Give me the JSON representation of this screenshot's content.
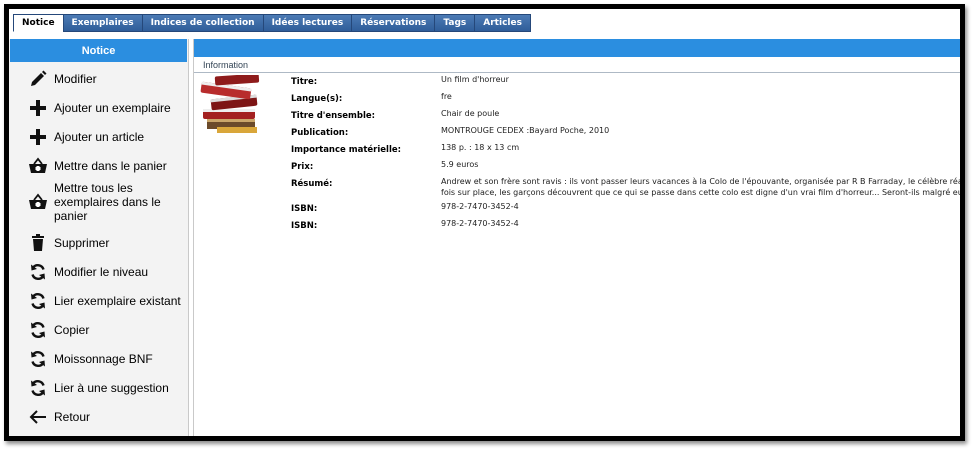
{
  "tabs": [
    {
      "label": "Notice",
      "active": true
    },
    {
      "label": "Exemplaires",
      "active": false
    },
    {
      "label": "Indices de collection",
      "active": false
    },
    {
      "label": "Idées lectures",
      "active": false
    },
    {
      "label": "Réservations",
      "active": false
    },
    {
      "label": "Tags",
      "active": false
    },
    {
      "label": "Articles",
      "active": false
    }
  ],
  "sidebar": {
    "header": "Notice",
    "items": [
      {
        "label": "Modifier",
        "icon": "pencil-icon"
      },
      {
        "label": "Ajouter un exemplaire",
        "icon": "plus-icon"
      },
      {
        "label": "Ajouter un article",
        "icon": "plus-icon"
      },
      {
        "label": "Mettre dans le panier",
        "icon": "basket-icon"
      },
      {
        "label": "Mettre tous les exemplaires dans le panier",
        "icon": "basket-icon"
      },
      {
        "label": "Supprimer",
        "icon": "trash-icon"
      },
      {
        "label": "Modifier le niveau",
        "icon": "refresh-icon"
      },
      {
        "label": "Lier exemplaire existant",
        "icon": "refresh-icon"
      },
      {
        "label": "Copier",
        "icon": "refresh-icon"
      },
      {
        "label": "Moissonnage BNF",
        "icon": "refresh-icon"
      },
      {
        "label": "Lier à une suggestion",
        "icon": "refresh-icon"
      },
      {
        "label": "Retour",
        "icon": "arrow-left-icon"
      }
    ]
  },
  "main": {
    "section_title": "Information",
    "cover_icon": "books-icon",
    "fields": [
      {
        "key": "Titre:",
        "value": "Un film d'horreur"
      },
      {
        "key": "Langue(s):",
        "value": "fre"
      },
      {
        "key": "Titre d'ensemble:",
        "value": "Chair de poule"
      },
      {
        "key": "Publication:",
        "value": "MONTROUGE CEDEX :Bayard Poche, 2010"
      },
      {
        "key": "Importance matérielle:",
        "value": "138 p. : 18 x 13 cm"
      },
      {
        "key": "Prix:",
        "value": "5.9 euros"
      },
      {
        "key": "Résumé:",
        "value": "Andrew et son frère sont ravis : ils vont passer leurs vacances à la Colo de l'épouvante, organisée par R B Farraday, le célèbre réalisat",
        "value2": "fois sur place, les garçons découvrent que ce qui se passe dans cette colo est digne d'un vrai film d'horreur... Seront-ils malgré eux les"
      },
      {
        "key": "ISBN:",
        "value": "978-2-7470-3452-4"
      },
      {
        "key": "ISBN:",
        "value": "978-2-7470-3452-4"
      }
    ]
  },
  "colors": {
    "accent": "#2b8ee0",
    "tab": "#2f5d99",
    "frame": "#000000"
  }
}
